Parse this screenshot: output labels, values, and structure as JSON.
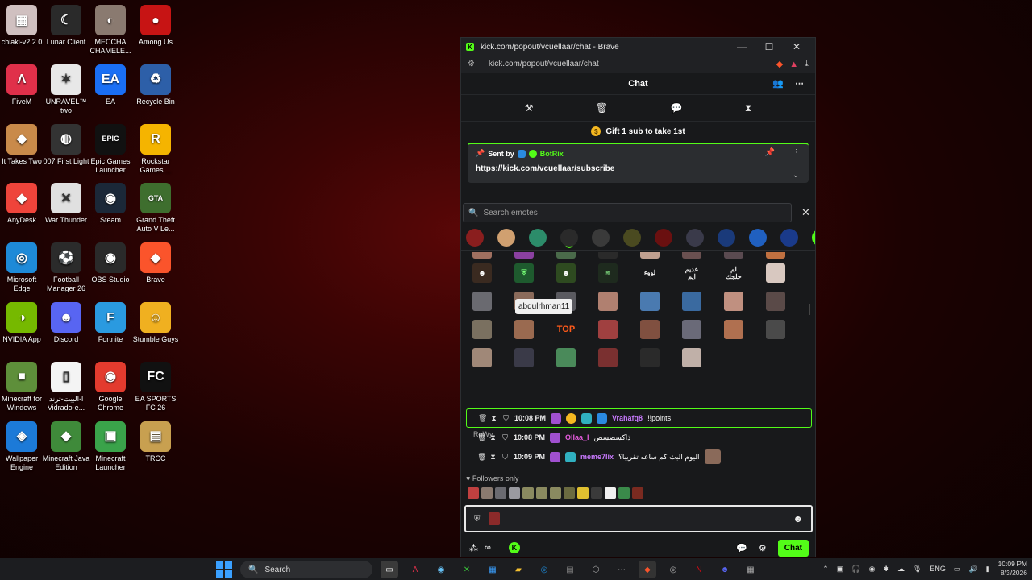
{
  "desktop": {
    "icons": [
      {
        "label": "chiaki-v2.2.0",
        "color": "#d0c0c0",
        "glyph": "▦"
      },
      {
        "label": "Lunar Client",
        "color": "#2a2a2a",
        "glyph": "☾"
      },
      {
        "label": "MECCHA CHAMELE...",
        "color": "#8a7a70",
        "glyph": "◐"
      },
      {
        "label": "Among Us",
        "color": "#c71414",
        "glyph": "●"
      },
      {
        "label": "FiveM",
        "color": "#e0304a",
        "glyph": "Λ"
      },
      {
        "label": "UNRAVEL™ two",
        "color": "#e8e8e8",
        "glyph": "✶"
      },
      {
        "label": "EA",
        "color": "#1a6ff5",
        "glyph": "EA"
      },
      {
        "label": "Recycle Bin",
        "color": "#2d5fa8",
        "glyph": "♻"
      },
      {
        "label": "It Takes Two",
        "color": "#c98a4a",
        "glyph": "◆"
      },
      {
        "label": "007 First Light",
        "color": "#333333",
        "glyph": "◍"
      },
      {
        "label": "Epic Games Launcher",
        "color": "#111111",
        "glyph": "EPIC"
      },
      {
        "label": "Rockstar Games ...",
        "color": "#f5b400",
        "glyph": "R"
      },
      {
        "label": "AnyDesk",
        "color": "#ef443b",
        "glyph": "◆"
      },
      {
        "label": "War Thunder",
        "color": "#e0e0e0",
        "glyph": "✕"
      },
      {
        "label": "Steam",
        "color": "#1b2838",
        "glyph": "◉"
      },
      {
        "label": "Grand Theft Auto V Le...",
        "color": "#3e6e2e",
        "glyph": "GTA"
      },
      {
        "label": "Microsoft Edge",
        "color": "#1e8ad8",
        "glyph": "◎"
      },
      {
        "label": "Football Manager 26",
        "color": "#2b2b2b",
        "glyph": "⚽"
      },
      {
        "label": "OBS Studio",
        "color": "#2a2a2a",
        "glyph": "◉"
      },
      {
        "label": "Brave",
        "color": "#fb542b",
        "glyph": "◆"
      },
      {
        "label": "NVIDIA App",
        "color": "#76b900",
        "glyph": "◑"
      },
      {
        "label": "Discord",
        "color": "#5865f2",
        "glyph": "☻"
      },
      {
        "label": "Fortnite",
        "color": "#2a9ae0",
        "glyph": "F"
      },
      {
        "label": "Stumble Guys",
        "color": "#f0b020",
        "glyph": "☺"
      },
      {
        "label": "Minecraft for Windows",
        "color": "#5e8f3a",
        "glyph": "■"
      },
      {
        "label": "البيت-ترند-l Vidrado-e...",
        "color": "#f4f4f4",
        "glyph": "▯"
      },
      {
        "label": "Google Chrome",
        "color": "#e33b2e",
        "glyph": "◉"
      },
      {
        "label": "EA SPORTS FC 26",
        "color": "#111111",
        "glyph": "FC"
      },
      {
        "label": "Wallpaper Engine",
        "color": "#1c7ad8",
        "glyph": "◈"
      },
      {
        "label": "Minecraft Java Edition",
        "color": "#3f8a3a",
        "glyph": "◆"
      },
      {
        "label": "Minecraft Launcher",
        "color": "#3aa34a",
        "glyph": "▣"
      },
      {
        "label": "TRCC",
        "color": "#c8a050",
        "glyph": "▤"
      }
    ]
  },
  "browser": {
    "window_title": "kick.com/popout/vcuellaar/chat - Brave",
    "url": "kick.com/popout/vcuellaar/chat",
    "chat_header": "Chat",
    "gift_text": "Gift 1 sub to take 1st",
    "pinned": {
      "sent_by": "Sent by",
      "author": "BotRix",
      "link": "https://kick.com/vcuellaar/subscribe"
    },
    "emotes": {
      "search_placeholder": "Search emotes",
      "tooltip": "abdulrhman11",
      "section_label": "RpWy",
      "tab_colors": [
        "#8a1e1e",
        "#d0a070",
        "#2c8c6a",
        "#2a2a2a",
        "#3a3a3a",
        "#4a4a20",
        "#6a1010",
        "#3a3a4a",
        "#1a3a7a",
        "#2060c0",
        "#1a3a8a",
        "#53fc18"
      ],
      "text_emotes": {
        "loooa": "لووء",
        "adeem": "عديم ايم",
        "lam": "لم حلجك",
        "top": "TOP"
      }
    },
    "messages": [
      {
        "time": "10:08 PM",
        "user": "Vrahafq8",
        "text": "!!points",
        "user_color": "#c97aff",
        "highlight": true
      },
      {
        "time": "10:08 PM",
        "user": "Ollaa_l",
        "text": "ذاكسصسص",
        "user_color": "#e75de0",
        "highlight": false
      },
      {
        "time": "10:09 PM",
        "user": "meme7lix",
        "text": "اليوم البث كم ساعه تقريبا؟",
        "user_color": "#c97aff",
        "highlight": false
      }
    ],
    "followers_only": "Followers only",
    "chat_button": "Chat"
  },
  "taskbar": {
    "search_label": "Search",
    "language": "ENG",
    "time": "10:09 PM",
    "date": "8/3/2026"
  }
}
